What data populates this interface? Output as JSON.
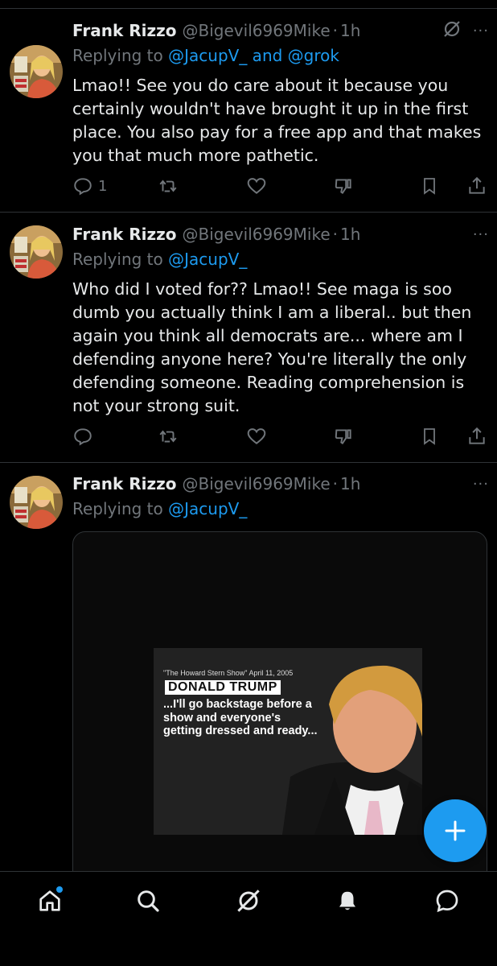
{
  "tweets": [
    {
      "name": "Frank Rizzo",
      "handle": "@Bigevil6969Mike",
      "time": "1h",
      "reply_prefix": "Replying to ",
      "reply_mentions": "@JacupV_ and @grok",
      "text": "Lmao!! See you do care about it because you certainly wouldn't have brought it up in the first place. You also pay for a free app and that makes you that much more pathetic.",
      "reply_count": "1"
    },
    {
      "name": "Frank Rizzo",
      "handle": "@Bigevil6969Mike",
      "time": "1h",
      "reply_prefix": "Replying to ",
      "reply_mentions": "@JacupV_",
      "text": "Who did I voted for?? Lmao!! See maga is soo dumb you actually think I am a liberal.. but then again you think all democrats are... where am I defending anyone here? You're literally the only defending someone. Reading comprehension is not your strong suit.",
      "reply_count": ""
    },
    {
      "name": "Frank Rizzo",
      "handle": "@Bigevil6969Mike",
      "time": "1h",
      "reply_prefix": "Replying to ",
      "reply_mentions": "@JacupV_",
      "media": {
        "caption": "\"The Howard Stern Show\" April 11, 2005",
        "name_label": "DONALD TRUMP",
        "quote": "...I'll go backstage before a show and everyone's getting dressed and ready..."
      }
    }
  ],
  "separator": "·",
  "more": "···",
  "nav": {
    "items": [
      "home-icon",
      "search-icon",
      "grok-icon",
      "notifications-icon",
      "messages-icon"
    ],
    "home_has_badge": true
  },
  "colors": {
    "background": "#000000",
    "accent": "#1d9bf0",
    "text": "#e7e9ea",
    "muted": "#71767b",
    "divider": "#2f3336"
  }
}
